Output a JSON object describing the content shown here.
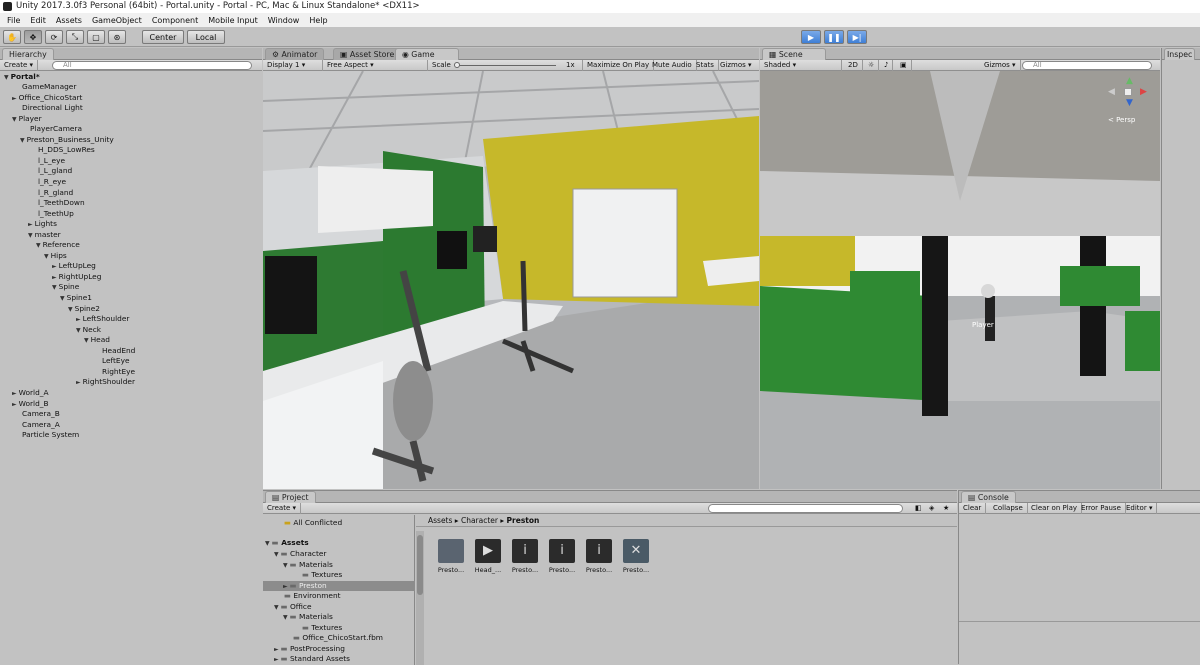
{
  "window": {
    "title": "Unity 2017.3.0f3 Personal (64bit) - Portal.unity - Portal - PC, Mac & Linux Standalone* <DX11>"
  },
  "menu": [
    "File",
    "Edit",
    "Assets",
    "GameObject",
    "Component",
    "Mobile Input",
    "Window",
    "Help"
  ],
  "toolbar": {
    "center_label": "Center",
    "local_label": "Local",
    "tools": [
      "hand-icon",
      "move-icon",
      "rotate-icon",
      "scale-icon",
      "rect-icon",
      "transform-icon"
    ],
    "play_icons": [
      "play-icon",
      "pause-icon",
      "step-icon"
    ]
  },
  "hierarchy": {
    "tab": "Hierarchy",
    "create": "Create",
    "search_placeholder": "All",
    "scene": "Portal*",
    "items": [
      {
        "label": "GameManager",
        "depth": 1,
        "arrow": ""
      },
      {
        "label": "Office_ChicoStart",
        "depth": 1,
        "arrow": "►"
      },
      {
        "label": "Directional Light",
        "depth": 1,
        "arrow": ""
      },
      {
        "label": "Player",
        "depth": 1,
        "arrow": "▼"
      },
      {
        "label": "PlayerCamera",
        "depth": 2,
        "arrow": ""
      },
      {
        "label": "Preston_Business_Unity",
        "depth": 2,
        "arrow": "▼"
      },
      {
        "label": "H_DDS_LowRes",
        "depth": 3,
        "arrow": ""
      },
      {
        "label": "l_L_eye",
        "depth": 3,
        "arrow": ""
      },
      {
        "label": "l_L_gland",
        "depth": 3,
        "arrow": ""
      },
      {
        "label": "l_R_eye",
        "depth": 3,
        "arrow": ""
      },
      {
        "label": "l_R_gland",
        "depth": 3,
        "arrow": ""
      },
      {
        "label": "l_TeethDown",
        "depth": 3,
        "arrow": ""
      },
      {
        "label": "l_TeethUp",
        "depth": 3,
        "arrow": ""
      },
      {
        "label": "Lights",
        "depth": 3,
        "arrow": "►"
      },
      {
        "label": "master",
        "depth": 3,
        "arrow": "▼"
      },
      {
        "label": "Reference",
        "depth": 4,
        "arrow": "▼"
      },
      {
        "label": "Hips",
        "depth": 5,
        "arrow": "▼"
      },
      {
        "label": "LeftUpLeg",
        "depth": 6,
        "arrow": "►"
      },
      {
        "label": "RightUpLeg",
        "depth": 6,
        "arrow": "►"
      },
      {
        "label": "Spine",
        "depth": 6,
        "arrow": "▼"
      },
      {
        "label": "Spine1",
        "depth": 7,
        "arrow": "▼"
      },
      {
        "label": "Spine2",
        "depth": 8,
        "arrow": "▼"
      },
      {
        "label": "LeftShoulder",
        "depth": 9,
        "arrow": "►"
      },
      {
        "label": "Neck",
        "depth": 9,
        "arrow": "▼"
      },
      {
        "label": "Head",
        "depth": 10,
        "arrow": "▼"
      },
      {
        "label": "HeadEnd",
        "depth": 11,
        "arrow": ""
      },
      {
        "label": "LeftEye",
        "depth": 11,
        "arrow": ""
      },
      {
        "label": "RightEye",
        "depth": 11,
        "arrow": ""
      },
      {
        "label": "RightShoulder",
        "depth": 9,
        "arrow": "►"
      },
      {
        "label": "World_A",
        "depth": 1,
        "arrow": "►"
      },
      {
        "label": "World_B",
        "depth": 1,
        "arrow": "►"
      },
      {
        "label": "Camera_B",
        "depth": 1,
        "arrow": ""
      },
      {
        "label": "Camera_A",
        "depth": 1,
        "arrow": ""
      },
      {
        "label": "Particle System",
        "depth": 1,
        "arrow": ""
      }
    ]
  },
  "game": {
    "tabs": [
      "Animator",
      "Asset Store",
      "Game"
    ],
    "display": "Display 1",
    "aspect": "Free Aspect",
    "scale_label": "Scale",
    "scale_value": "1x",
    "maximize": "Maximize On Play",
    "mute": "Mute Audio",
    "stats": "Stats",
    "gizmos": "Gizmos"
  },
  "scene": {
    "tab": "Scene",
    "shading": "Shaded",
    "mode_2d": "2D",
    "gizmos": "Gizmos",
    "search_placeholder": "All",
    "persp": "< Persp",
    "player_label": "Player"
  },
  "inspector": {
    "tab": "Inspec"
  },
  "project": {
    "tab": "Project",
    "create": "Create",
    "breadcrumb": [
      "Assets",
      "Character",
      "Preston"
    ],
    "tree": [
      {
        "label": "All Conflicted",
        "depth": 1,
        "arrow": ""
      },
      {
        "label": "Assets",
        "depth": 0,
        "arrow": "▼",
        "bold": true
      },
      {
        "label": "Character",
        "depth": 1,
        "arrow": "▼"
      },
      {
        "label": "Materials",
        "depth": 2,
        "arrow": "▼"
      },
      {
        "label": "Textures",
        "depth": 3,
        "arrow": ""
      },
      {
        "label": "Preston",
        "depth": 2,
        "arrow": "►",
        "selected": true
      },
      {
        "label": "Environment",
        "depth": 1,
        "arrow": ""
      },
      {
        "label": "Office",
        "depth": 1,
        "arrow": "▼"
      },
      {
        "label": "Materials",
        "depth": 2,
        "arrow": "▼"
      },
      {
        "label": "Textures",
        "depth": 3,
        "arrow": ""
      },
      {
        "label": "Office_ChicoStart.fbm",
        "depth": 2,
        "arrow": ""
      },
      {
        "label": "PostProcessing",
        "depth": 1,
        "arrow": "►"
      },
      {
        "label": "Standard Assets",
        "depth": 1,
        "arrow": "►"
      }
    ],
    "assets": [
      {
        "label": "Presto...",
        "icon": "folder-icon"
      },
      {
        "label": "Head_...",
        "icon": "animation-icon"
      },
      {
        "label": "Presto...",
        "icon": "model-icon"
      },
      {
        "label": "Presto...",
        "icon": "model-icon"
      },
      {
        "label": "Presto...",
        "icon": "model-icon"
      },
      {
        "label": "Presto...",
        "icon": "prefab-icon"
      }
    ]
  },
  "console": {
    "tab": "Console",
    "buttons": [
      "Clear",
      "Collapse",
      "Clear on Play",
      "Error Pause",
      "Editor"
    ]
  }
}
